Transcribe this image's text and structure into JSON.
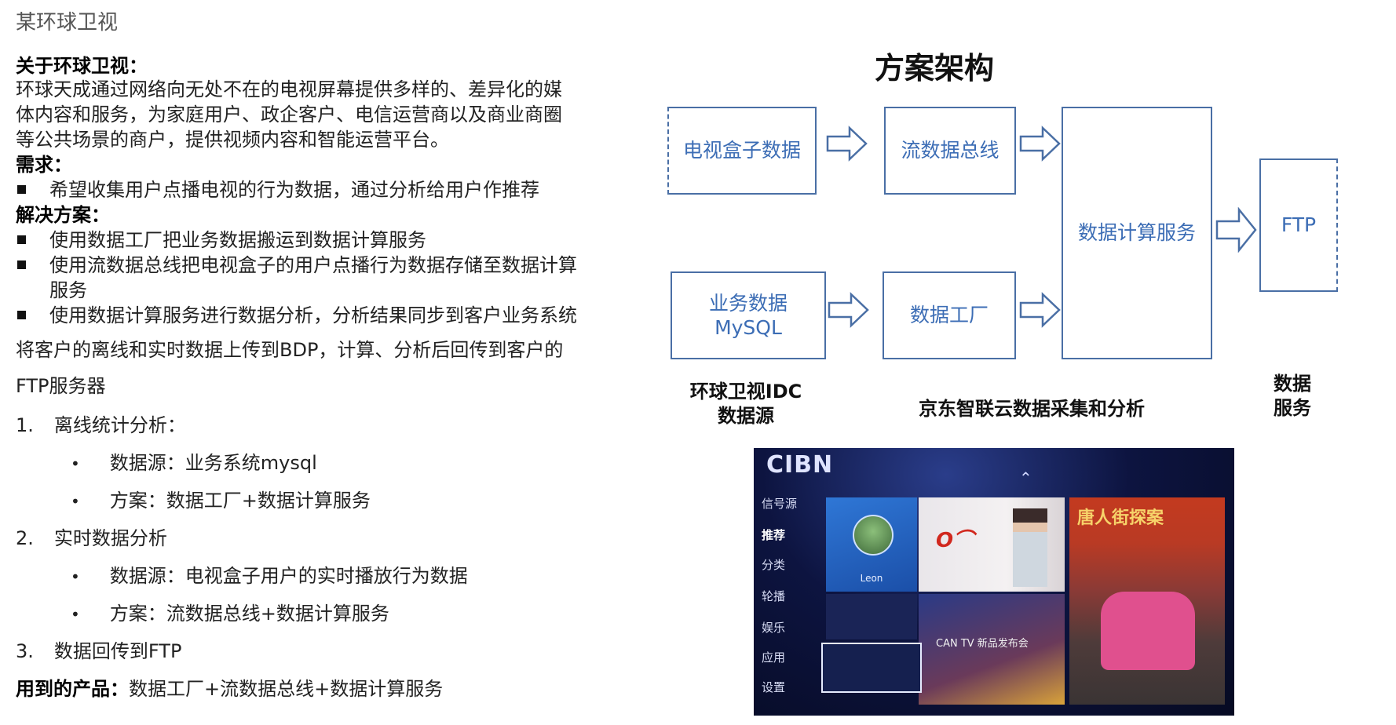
{
  "page_title": "某环球卫视",
  "about": {
    "heading": "关于环球卫视：",
    "lines": [
      "环球天成通过网络向无处不在的电视屏幕提供多样的、差异化的媒",
      "体内容和服务，为家庭用户、政企客户、电信运营商以及商业商圈",
      "等公共场景的商户，提供视频内容和智能运营平台。"
    ]
  },
  "requirement": {
    "heading": "需求：",
    "items": [
      "希望收集用户点播电视的行为数据，通过分析给用户作推荐"
    ]
  },
  "solution": {
    "heading": "解决方案：",
    "items": [
      "使用数据工厂把业务数据搬运到数据计算服务",
      "使用流数据总线把电视盒子的用户点播行为数据存储至数据计算",
      "服务",
      "使用数据计算服务进行数据分析，分析结果同步到客户业务系统"
    ]
  },
  "summary": {
    "line1": "将客户的离线和实时数据上传到BDP，计算、分析后回传到客户的",
    "line2": "FTP服务器"
  },
  "steps": [
    {
      "num": "1.",
      "label": "离线统计分析：",
      "subs": [
        "数据源：业务系统mysql",
        "方案：数据工厂+数据计算服务"
      ]
    },
    {
      "num": "2.",
      "label": "实时数据分析",
      "subs": [
        "数据源：电视盒子用户的实时播放行为数据",
        "方案：流数据总线+数据计算服务"
      ]
    },
    {
      "num": "3.",
      "label": "数据回传到FTP",
      "subs": []
    }
  ],
  "products": {
    "label": "用到的产品：",
    "value": "数据工厂+流数据总线+数据计算服务"
  },
  "diagram": {
    "title": "方案架构",
    "boxes": {
      "tv_box": "电视盒子数据",
      "stream_bus": "流数据总线",
      "compute": "数据计算服务",
      "ftp": "FTP",
      "biz_data_1": "业务数据",
      "biz_data_2": "MySQL",
      "data_factory": "数据工厂"
    },
    "captions": {
      "idc_1": "环球卫视IDC",
      "idc_2": "数据源",
      "jd": "京东智联云数据采集和分析",
      "svc_1": "数据",
      "svc_2": "服务"
    },
    "arrow_color": "#4a6fa5",
    "box_text_color": "#3c6db5"
  },
  "tv_screen": {
    "logo": "CIBN",
    "menu": [
      "信号源",
      "推荐",
      "分类",
      "轮播",
      "娱乐",
      "应用",
      "设置"
    ],
    "user": "Leon",
    "tile_text": "CAN TV 新品发布会",
    "poster_title": "唐人街探案"
  }
}
